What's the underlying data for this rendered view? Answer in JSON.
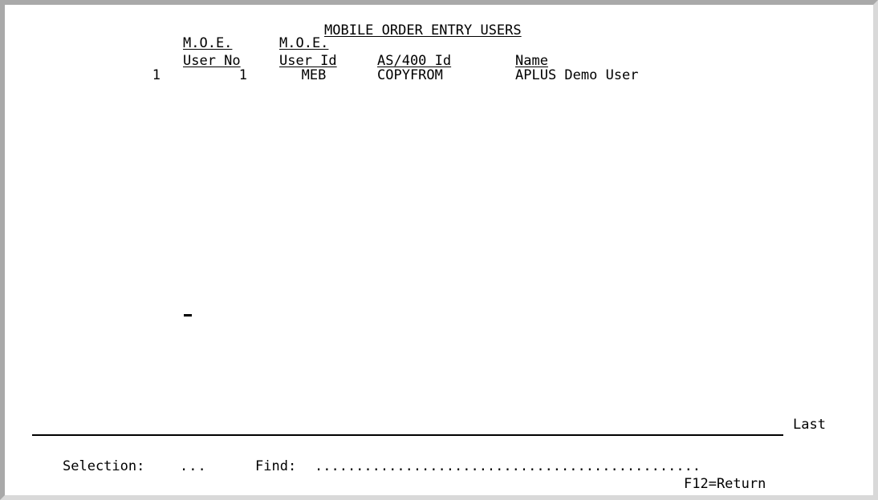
{
  "screen": {
    "title": "MOBILE ORDER ENTRY USERS",
    "columns": {
      "user_no": {
        "line1": "M.O.E.",
        "line2": "User No"
      },
      "user_id": {
        "line1": "M.O.E.",
        "line2": "User Id"
      },
      "as400_id": {
        "label": "AS/400 Id"
      },
      "name": {
        "label": "Name"
      }
    },
    "rows": [
      {
        "seq": "1",
        "user_no": "1",
        "user_id": "MEB",
        "as400_id": "COPYFROM",
        "name": "APLUS Demo User"
      }
    ],
    "footer": {
      "last_label": "Last",
      "selection_label": "Selection:",
      "selection_value": "...",
      "find_label": "Find:",
      "find_value": "...............................................",
      "f12_label": "F12=Return"
    }
  }
}
